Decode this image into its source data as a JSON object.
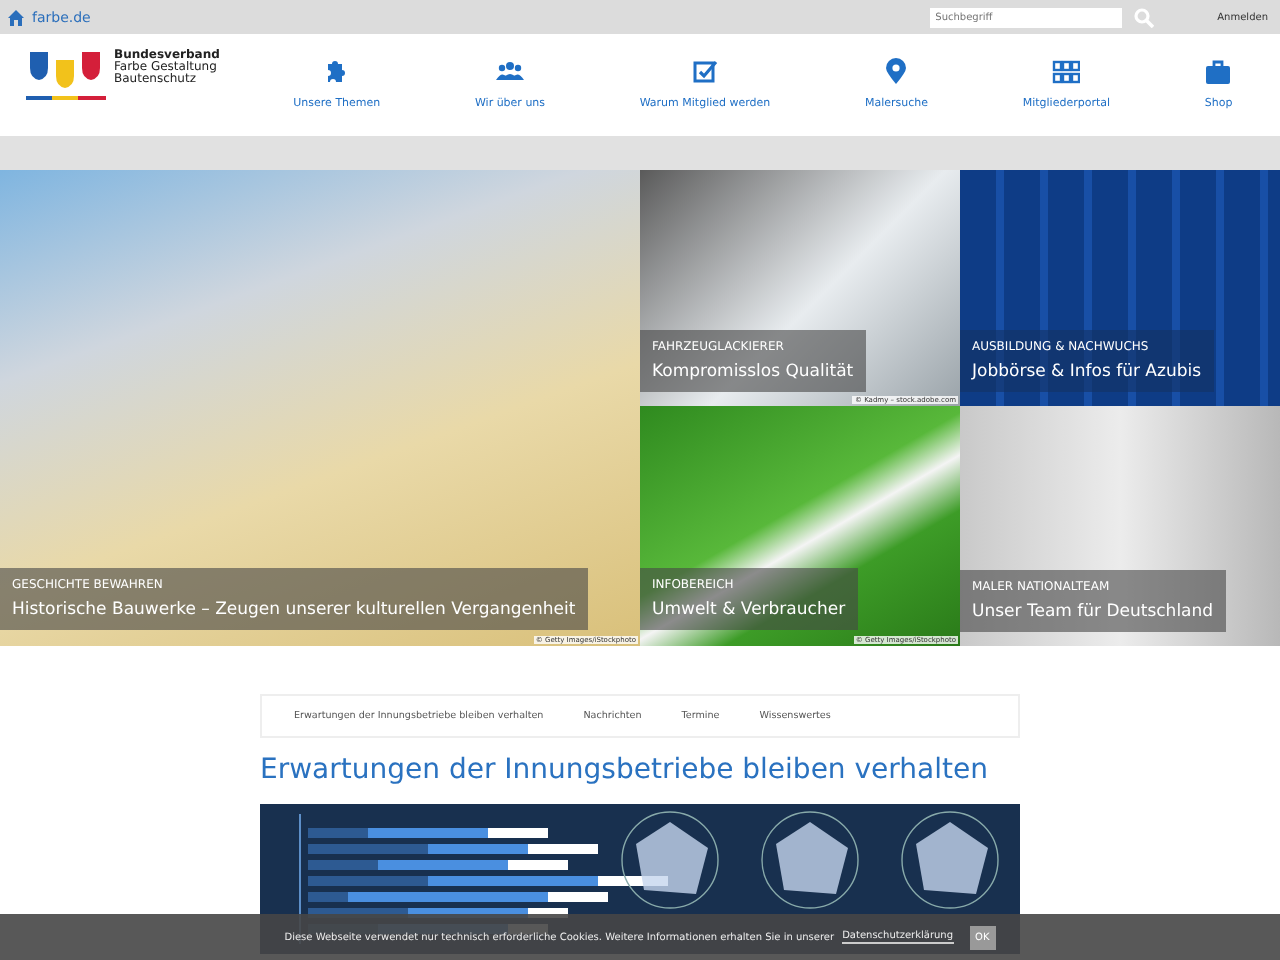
{
  "topbar": {
    "site": "farbe.de",
    "search": {
      "placeholder": "Suchbegriff"
    },
    "login": "Anmelden"
  },
  "logo": {
    "lines": [
      "Bundesverband",
      "Farbe Gestaltung",
      "Bautenschutz"
    ]
  },
  "nav": [
    {
      "label": "Unsere Themen",
      "kind": "puzzle"
    },
    {
      "label": "Wir über uns",
      "kind": "group"
    },
    {
      "label": "Warum Mitglied werden",
      "kind": "check"
    },
    {
      "label": "Malersuche",
      "kind": "pin"
    },
    {
      "label": "Mitgliederportal",
      "kind": "grid"
    },
    {
      "label": "Shop",
      "kind": "bag"
    }
  ],
  "tiles": [
    {
      "kicker": "FAHRZEUGLACKIERER",
      "title": "Kompromisslos Qualität",
      "credit": "© Kadmy – stock.adobe.com",
      "kind": "painter"
    },
    {
      "kicker": "AUSBILDUNG & NACHWUCHS",
      "title": "Jobbörse & Infos für Azubis",
      "kind": "blue"
    },
    {
      "kicker": "GESCHICHTE BEWAHREN",
      "title": "Historische Bauwerke – Zeugen unserer kulturellen Vergangenheit",
      "credit": "© Getty Images/iStockphoto",
      "kind": "houses"
    },
    {
      "kicker": "INFOBEREICH",
      "title": "Umwelt & Verbraucher",
      "credit": "© Getty Images/iStockphoto",
      "kind": "grass"
    },
    {
      "kicker": "MALER NATIONALTEAM",
      "title": "Unser Team für Deutschland",
      "kind": "team"
    }
  ],
  "tabs": [
    {
      "label": "Erwartungen der Innungsbetriebe bleiben verhalten"
    },
    {
      "label": "Nachrichten"
    },
    {
      "label": "Termine"
    },
    {
      "label": "Wissenswertes"
    }
  ],
  "article": {
    "title": "Erwartungen der Innungsbetriebe bleiben verhalten"
  },
  "cookie": {
    "text": "Diese Webseite verwendet nur technisch erforderliche Cookies. Weitere Informationen erhalten Sie in unserer",
    "link": "Datenschutzerklärung",
    "button": "OK"
  }
}
